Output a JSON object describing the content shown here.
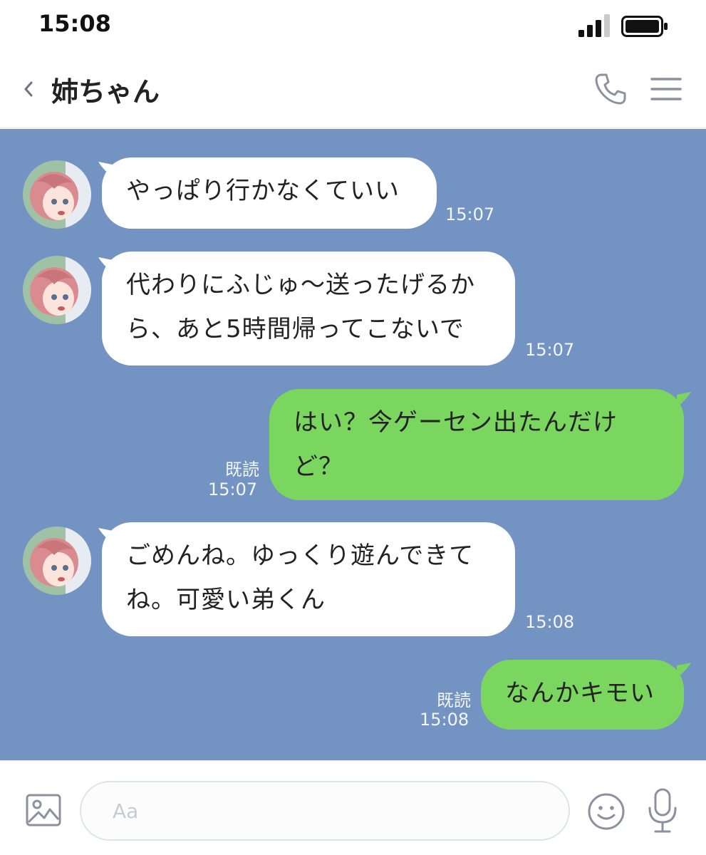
{
  "status_bar": {
    "time": "15:08",
    "signal_icon": "signal-bars-icon",
    "battery_icon": "battery-icon"
  },
  "header": {
    "back_icon": "chevron-left-icon",
    "title": "姉ちゃん",
    "call_icon": "phone-icon",
    "menu_icon": "hamburger-menu-icon"
  },
  "colors": {
    "chat_background": "#7393c2",
    "incoming_bubble": "#ffffff",
    "outgoing_bubble": "#7bd65f"
  },
  "messages": [
    {
      "direction": "incoming",
      "lines": [
        "やっぱり行かなくていい"
      ],
      "time": "15:07"
    },
    {
      "direction": "incoming",
      "lines": [
        "代わりにふじゅ〜送ったげるか",
        "ら、あと5時間帰ってこないで"
      ],
      "time": "15:07"
    },
    {
      "direction": "outgoing",
      "lines": [
        "はい？今ゲーセン出たんだけ",
        "ど？"
      ],
      "read": "既読",
      "time": "15:07"
    },
    {
      "direction": "incoming",
      "lines": [
        "ごめんね。ゆっくり遊んできて",
        "ね。可愛い弟くん"
      ],
      "time": "15:08"
    },
    {
      "direction": "outgoing",
      "lines": [
        "なんかキモい"
      ],
      "read": "既読",
      "time": "15:08"
    }
  ],
  "input_bar": {
    "photo_icon": "image-icon",
    "placeholder": "Aa",
    "emoji_icon": "smiley-icon",
    "mic_icon": "microphone-icon"
  }
}
